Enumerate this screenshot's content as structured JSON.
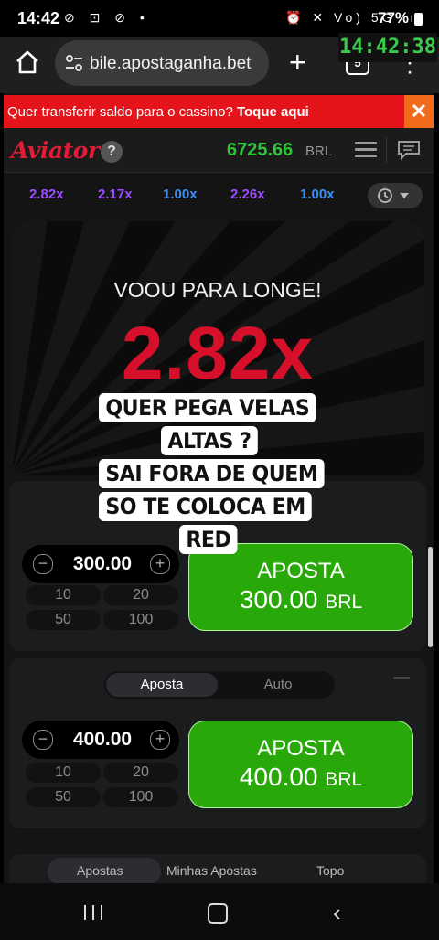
{
  "status_bar": {
    "time": "14:42",
    "left_icons": "⊘ ⊡ ⊘ •",
    "right_icons": "⏰ ✕ Vo) 5G .ıl",
    "battery": "77%"
  },
  "browser": {
    "url": "bile.apostaganha.bet",
    "tab_count": "5",
    "overlay_clock": "14:42:38"
  },
  "banner": {
    "text": "Quer transferir saldo para o cassino?",
    "action": "Toque aqui",
    "close": "✕"
  },
  "game_header": {
    "logo": "Aviator",
    "help": "?",
    "balance": "6725.66",
    "currency": "BRL"
  },
  "history": {
    "items": [
      {
        "value": "2.82x",
        "color": "#9b4dff"
      },
      {
        "value": "2.17x",
        "color": "#9b4dff"
      },
      {
        "value": "1.00x",
        "color": "#3d8ef0"
      },
      {
        "value": "2.26x",
        "color": "#9b4dff"
      },
      {
        "value": "1.00x",
        "color": "#3d8ef0"
      }
    ]
  },
  "game": {
    "status": "VOOU PARA LONGE!",
    "multiplier": "2.82x"
  },
  "caption": {
    "lines": [
      "QUER PEGA VELAS",
      "ALTAS ?",
      "SAI FORA DE QUEM",
      "SO TE COLOCA EM",
      "RED"
    ]
  },
  "bet1": {
    "amount": "300.00",
    "quick": [
      "10",
      "20",
      "50",
      "100"
    ],
    "button_label": "APOSTA",
    "button_amount": "300.00",
    "button_currency": "BRL"
  },
  "bet2": {
    "tabs": [
      "Aposta",
      "Auto"
    ],
    "amount": "400.00",
    "quick": [
      "10",
      "20",
      "50",
      "100"
    ],
    "button_label": "APOSTA",
    "button_amount": "400.00",
    "button_currency": "BRL"
  },
  "bottom_tabs": [
    "Apostas",
    "Minhas Apostas",
    "Topo"
  ]
}
